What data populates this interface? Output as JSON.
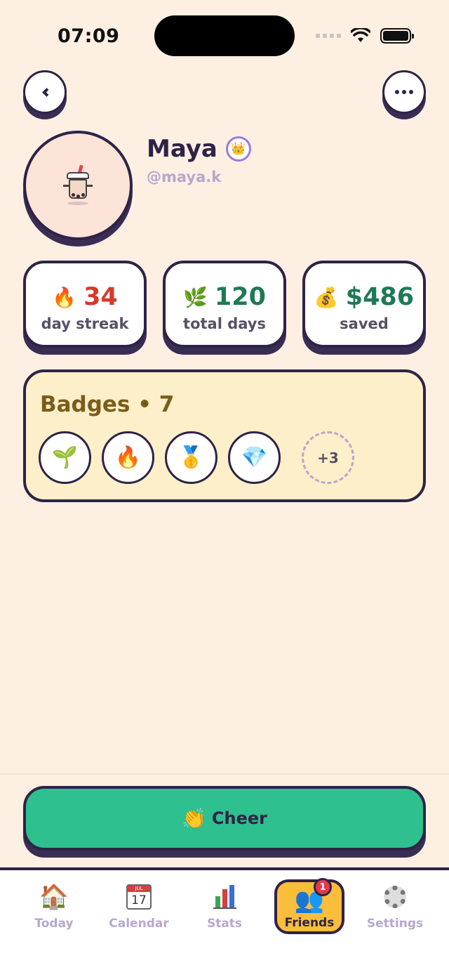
{
  "status_bar": {
    "time": "07:09"
  },
  "profile": {
    "name": "Maya",
    "handle": "@maya.k",
    "crown_icon": "👑",
    "avatar_icon": "boba-tea-mascot"
  },
  "stats": [
    {
      "icon": "🔥",
      "value": "34",
      "label": "day streak",
      "color": "#d63a2a"
    },
    {
      "icon": "🌿",
      "value": "120",
      "label": "total days",
      "color": "#1e7a55"
    },
    {
      "icon": "💰",
      "value": "$486",
      "label": "saved",
      "color": "#1e7a55"
    }
  ],
  "badges": {
    "title": "Badges • 7",
    "items": [
      "🌱",
      "🔥",
      "🥇",
      "💎"
    ],
    "more": "+3"
  },
  "cheer": {
    "icon": "👏",
    "label": "Cheer"
  },
  "tabs": [
    {
      "icon": "🏠",
      "label": "Today"
    },
    {
      "icon": "calendar",
      "label": "Calendar",
      "cal_month": "JUL",
      "cal_day": "17"
    },
    {
      "icon": "bar-chart",
      "label": "Stats"
    },
    {
      "icon": "👥",
      "label": "Friends",
      "badge": "1"
    },
    {
      "icon": "gear",
      "label": "Settings"
    }
  ]
}
